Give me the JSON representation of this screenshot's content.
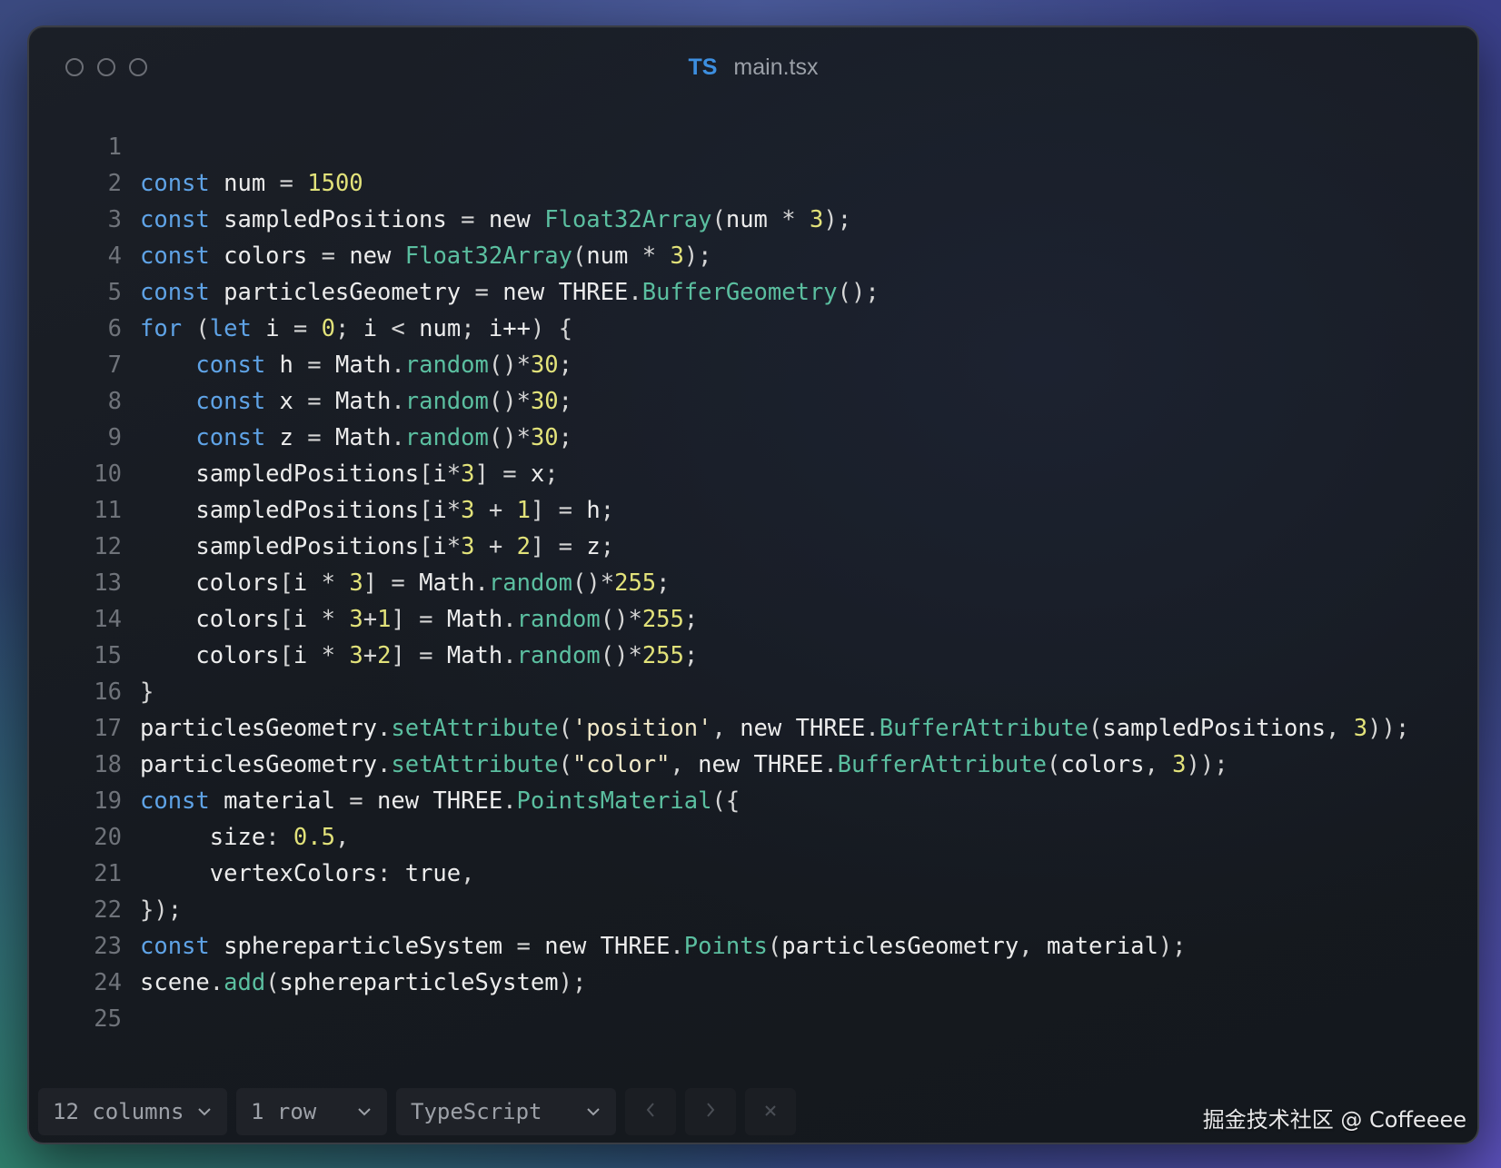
{
  "window": {
    "title_badge": "TS",
    "file_name": "main.tsx"
  },
  "code_lines": [
    {
      "n": "1",
      "tokens": []
    },
    {
      "n": "2",
      "tokens": [
        [
          "kw",
          "const"
        ],
        [
          "id",
          " num "
        ],
        [
          "p",
          "= "
        ],
        [
          "num",
          "1500"
        ]
      ]
    },
    {
      "n": "3",
      "tokens": [
        [
          "kw",
          "const"
        ],
        [
          "id",
          " sampledPositions "
        ],
        [
          "p",
          "= "
        ],
        [
          "id",
          "new "
        ],
        [
          "fn",
          "Float32Array"
        ],
        [
          "p",
          "("
        ],
        [
          "id",
          "num "
        ],
        [
          "p",
          "* "
        ],
        [
          "num",
          "3"
        ],
        [
          "p",
          ");"
        ]
      ]
    },
    {
      "n": "4",
      "tokens": [
        [
          "kw",
          "const"
        ],
        [
          "id",
          " colors "
        ],
        [
          "p",
          "= "
        ],
        [
          "id",
          "new "
        ],
        [
          "fn",
          "Float32Array"
        ],
        [
          "p",
          "("
        ],
        [
          "id",
          "num "
        ],
        [
          "p",
          "* "
        ],
        [
          "num",
          "3"
        ],
        [
          "p",
          ");"
        ]
      ]
    },
    {
      "n": "5",
      "tokens": [
        [
          "kw",
          "const"
        ],
        [
          "id",
          " particlesGeometry "
        ],
        [
          "p",
          "= "
        ],
        [
          "id",
          "new THREE"
        ],
        [
          "p",
          "."
        ],
        [
          "fn",
          "BufferGeometry"
        ],
        [
          "p",
          "();"
        ]
      ]
    },
    {
      "n": "6",
      "tokens": [
        [
          "kw",
          "for"
        ],
        [
          "p",
          " ("
        ],
        [
          "kw",
          "let"
        ],
        [
          "id",
          " i "
        ],
        [
          "p",
          "= "
        ],
        [
          "num",
          "0"
        ],
        [
          "p",
          "; "
        ],
        [
          "id",
          "i "
        ],
        [
          "p",
          "< "
        ],
        [
          "id",
          "num"
        ],
        [
          "p",
          "; "
        ],
        [
          "id",
          "i++"
        ],
        [
          "p",
          ") {"
        ]
      ]
    },
    {
      "n": "7",
      "tokens": [
        [
          "p",
          "    "
        ],
        [
          "kw",
          "const"
        ],
        [
          "id",
          " h "
        ],
        [
          "p",
          "= "
        ],
        [
          "id",
          "Math"
        ],
        [
          "p",
          "."
        ],
        [
          "fn",
          "random"
        ],
        [
          "p",
          "()*"
        ],
        [
          "num",
          "30"
        ],
        [
          "p",
          ";"
        ]
      ]
    },
    {
      "n": "8",
      "tokens": [
        [
          "p",
          "    "
        ],
        [
          "kw",
          "const"
        ],
        [
          "id",
          " x "
        ],
        [
          "p",
          "= "
        ],
        [
          "id",
          "Math"
        ],
        [
          "p",
          "."
        ],
        [
          "fn",
          "random"
        ],
        [
          "p",
          "()*"
        ],
        [
          "num",
          "30"
        ],
        [
          "p",
          ";"
        ]
      ]
    },
    {
      "n": "9",
      "tokens": [
        [
          "p",
          "    "
        ],
        [
          "kw",
          "const"
        ],
        [
          "id",
          " z "
        ],
        [
          "p",
          "= "
        ],
        [
          "id",
          "Math"
        ],
        [
          "p",
          "."
        ],
        [
          "fn",
          "random"
        ],
        [
          "p",
          "()*"
        ],
        [
          "num",
          "30"
        ],
        [
          "p",
          ";"
        ]
      ]
    },
    {
      "n": "10",
      "tokens": [
        [
          "p",
          "    "
        ],
        [
          "id",
          "sampledPositions"
        ],
        [
          "p",
          "["
        ],
        [
          "id",
          "i"
        ],
        [
          "p",
          "*"
        ],
        [
          "num",
          "3"
        ],
        [
          "p",
          "] = "
        ],
        [
          "id",
          "x"
        ],
        [
          "p",
          ";"
        ]
      ]
    },
    {
      "n": "11",
      "tokens": [
        [
          "p",
          "    "
        ],
        [
          "id",
          "sampledPositions"
        ],
        [
          "p",
          "["
        ],
        [
          "id",
          "i"
        ],
        [
          "p",
          "*"
        ],
        [
          "num",
          "3"
        ],
        [
          "p",
          " + "
        ],
        [
          "num",
          "1"
        ],
        [
          "p",
          "] = "
        ],
        [
          "id",
          "h"
        ],
        [
          "p",
          ";"
        ]
      ]
    },
    {
      "n": "12",
      "tokens": [
        [
          "p",
          "    "
        ],
        [
          "id",
          "sampledPositions"
        ],
        [
          "p",
          "["
        ],
        [
          "id",
          "i"
        ],
        [
          "p",
          "*"
        ],
        [
          "num",
          "3"
        ],
        [
          "p",
          " + "
        ],
        [
          "num",
          "2"
        ],
        [
          "p",
          "] = "
        ],
        [
          "id",
          "z"
        ],
        [
          "p",
          ";"
        ]
      ]
    },
    {
      "n": "13",
      "tokens": [
        [
          "p",
          "    "
        ],
        [
          "id",
          "colors"
        ],
        [
          "p",
          "["
        ],
        [
          "id",
          "i "
        ],
        [
          "p",
          "* "
        ],
        [
          "num",
          "3"
        ],
        [
          "p",
          "] = "
        ],
        [
          "id",
          "Math"
        ],
        [
          "p",
          "."
        ],
        [
          "fn",
          "random"
        ],
        [
          "p",
          "()*"
        ],
        [
          "num",
          "255"
        ],
        [
          "p",
          ";"
        ]
      ]
    },
    {
      "n": "14",
      "tokens": [
        [
          "p",
          "    "
        ],
        [
          "id",
          "colors"
        ],
        [
          "p",
          "["
        ],
        [
          "id",
          "i "
        ],
        [
          "p",
          "* "
        ],
        [
          "num",
          "3"
        ],
        [
          "p",
          "+"
        ],
        [
          "num",
          "1"
        ],
        [
          "p",
          "] = "
        ],
        [
          "id",
          "Math"
        ],
        [
          "p",
          "."
        ],
        [
          "fn",
          "random"
        ],
        [
          "p",
          "()*"
        ],
        [
          "num",
          "255"
        ],
        [
          "p",
          ";"
        ]
      ]
    },
    {
      "n": "15",
      "tokens": [
        [
          "p",
          "    "
        ],
        [
          "id",
          "colors"
        ],
        [
          "p",
          "["
        ],
        [
          "id",
          "i "
        ],
        [
          "p",
          "* "
        ],
        [
          "num",
          "3"
        ],
        [
          "p",
          "+"
        ],
        [
          "num",
          "2"
        ],
        [
          "p",
          "] = "
        ],
        [
          "id",
          "Math"
        ],
        [
          "p",
          "."
        ],
        [
          "fn",
          "random"
        ],
        [
          "p",
          "()*"
        ],
        [
          "num",
          "255"
        ],
        [
          "p",
          ";"
        ]
      ]
    },
    {
      "n": "16",
      "tokens": [
        [
          "p",
          "}"
        ]
      ]
    },
    {
      "n": "17",
      "tokens": [
        [
          "id",
          "particlesGeometry"
        ],
        [
          "p",
          "."
        ],
        [
          "fn",
          "setAttribute"
        ],
        [
          "p",
          "("
        ],
        [
          "str",
          "'position'"
        ],
        [
          "p",
          ", "
        ],
        [
          "id",
          "new THREE"
        ],
        [
          "p",
          "."
        ],
        [
          "fn",
          "BufferAttribute"
        ],
        [
          "p",
          "("
        ],
        [
          "id",
          "sampledPositions"
        ],
        [
          "p",
          ", "
        ],
        [
          "num",
          "3"
        ],
        [
          "p",
          "));"
        ]
      ]
    },
    {
      "n": "18",
      "tokens": [
        [
          "id",
          "particlesGeometry"
        ],
        [
          "p",
          "."
        ],
        [
          "fn",
          "setAttribute"
        ],
        [
          "p",
          "("
        ],
        [
          "str",
          "\"color\""
        ],
        [
          "p",
          ", "
        ],
        [
          "id",
          "new THREE"
        ],
        [
          "p",
          "."
        ],
        [
          "fn",
          "BufferAttribute"
        ],
        [
          "p",
          "("
        ],
        [
          "id",
          "colors"
        ],
        [
          "p",
          ", "
        ],
        [
          "num",
          "3"
        ],
        [
          "p",
          "));"
        ]
      ]
    },
    {
      "n": "19",
      "tokens": [
        [
          "kw",
          "const"
        ],
        [
          "id",
          " material "
        ],
        [
          "p",
          "= "
        ],
        [
          "id",
          "new THREE"
        ],
        [
          "p",
          "."
        ],
        [
          "fn",
          "PointsMaterial"
        ],
        [
          "p",
          "({"
        ]
      ]
    },
    {
      "n": "20",
      "tokens": [
        [
          "p",
          "     "
        ],
        [
          "id",
          "size"
        ],
        [
          "p",
          ": "
        ],
        [
          "num",
          "0.5"
        ],
        [
          "p",
          ","
        ]
      ]
    },
    {
      "n": "21",
      "tokens": [
        [
          "p",
          "     "
        ],
        [
          "id",
          "vertexColors"
        ],
        [
          "p",
          ": "
        ],
        [
          "id",
          "true"
        ],
        [
          "p",
          ","
        ]
      ]
    },
    {
      "n": "22",
      "tokens": [
        [
          "p",
          "});"
        ]
      ]
    },
    {
      "n": "23",
      "tokens": [
        [
          "kw",
          "const"
        ],
        [
          "id",
          " sphereparticleSystem "
        ],
        [
          "p",
          "= "
        ],
        [
          "id",
          "new THREE"
        ],
        [
          "p",
          "."
        ],
        [
          "fn",
          "Points"
        ],
        [
          "p",
          "("
        ],
        [
          "id",
          "particlesGeometry"
        ],
        [
          "p",
          ", "
        ],
        [
          "id",
          "material"
        ],
        [
          "p",
          ");"
        ]
      ]
    },
    {
      "n": "24",
      "tokens": [
        [
          "id",
          "scene"
        ],
        [
          "p",
          "."
        ],
        [
          "fn",
          "add"
        ],
        [
          "p",
          "("
        ],
        [
          "id",
          "sphereparticleSystem"
        ],
        [
          "p",
          ");"
        ]
      ]
    },
    {
      "n": "25",
      "tokens": []
    }
  ],
  "footer": {
    "columns_label": "12 columns",
    "rows_label": "1 row",
    "language_label": "TypeScript",
    "prev_icon": "chevron-left-icon",
    "next_icon": "chevron-right-icon",
    "close_icon": "close-icon"
  },
  "watermark": "掘金技术社区 @ Coffeeee",
  "colors": {
    "keyword": "#5fa3e6",
    "function": "#5bbfa0",
    "number": "#e2e27a",
    "identifier": "#ececec",
    "line_number": "#6f737a",
    "ts_badge": "#3d8fe0"
  }
}
